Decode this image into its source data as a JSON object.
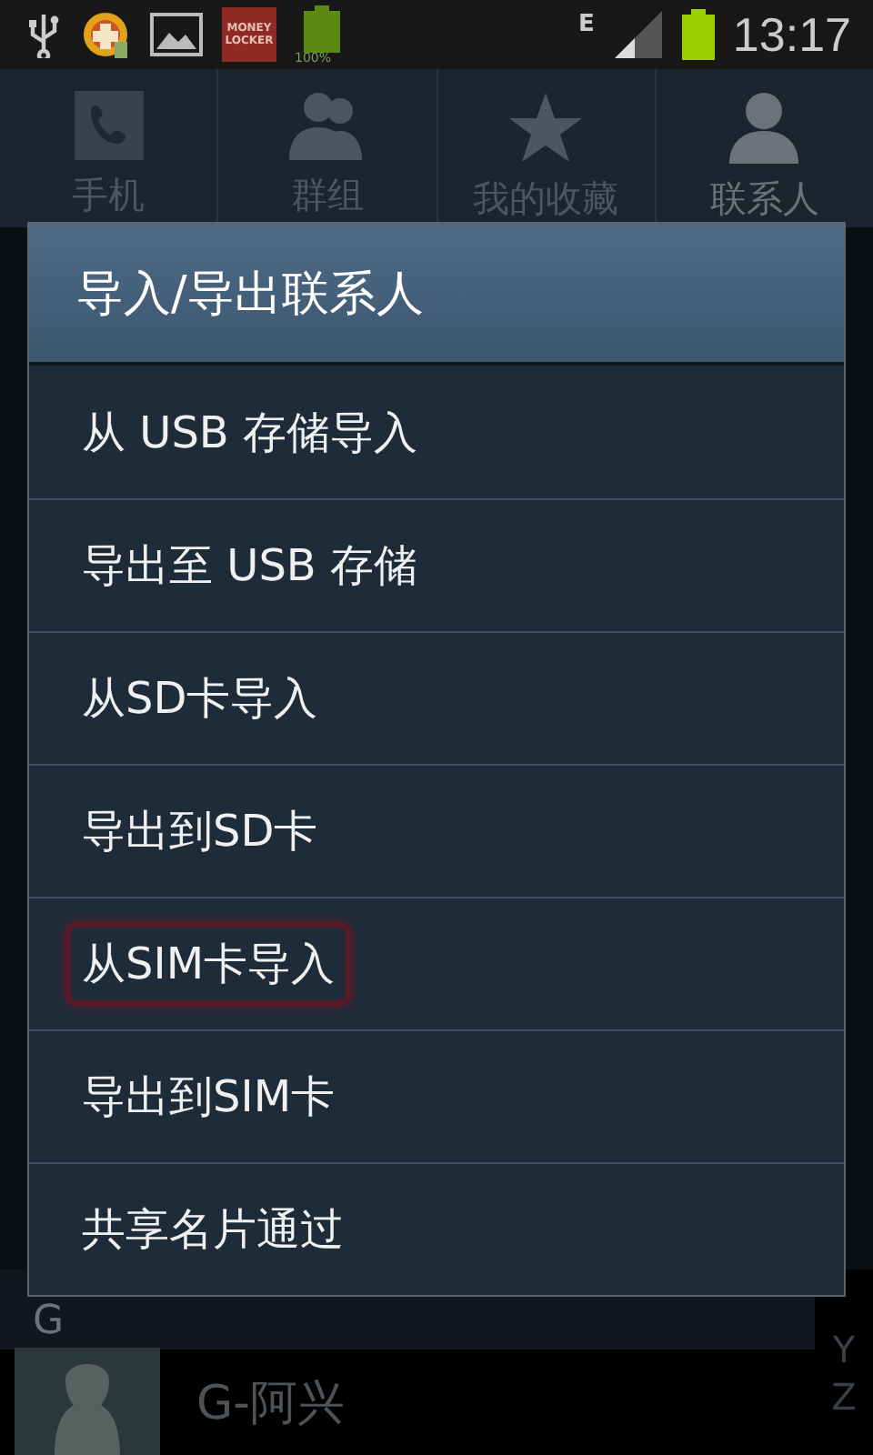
{
  "status_bar": {
    "notification_badge": [
      "MONEY",
      "LOCKER"
    ],
    "battery_label": "100%",
    "network": "E",
    "time": "13:17"
  },
  "tabs": [
    {
      "label": "手机",
      "kind": "phone",
      "selected": false
    },
    {
      "label": "群组",
      "kind": "group",
      "selected": false
    },
    {
      "label": "我的收藏",
      "kind": "star",
      "selected": false
    },
    {
      "label": "联系人",
      "kind": "person",
      "selected": true
    }
  ],
  "contacts": {
    "section": "G",
    "rows": [
      {
        "name": "G-阿兴"
      }
    ],
    "index_letters": [
      "Y",
      "Z"
    ]
  },
  "dialog": {
    "title": "导入/导出联系人",
    "items": [
      {
        "label": "从 USB 存储导入",
        "selected": false
      },
      {
        "label": "导出至 USB 存储",
        "selected": false
      },
      {
        "label": "从SD卡导入",
        "selected": false
      },
      {
        "label": "导出到SD卡",
        "selected": false
      },
      {
        "label": "从SIM卡导入",
        "selected": true
      },
      {
        "label": "导出到SIM卡",
        "selected": false
      },
      {
        "label": "共享名片通过",
        "selected": false
      }
    ]
  }
}
